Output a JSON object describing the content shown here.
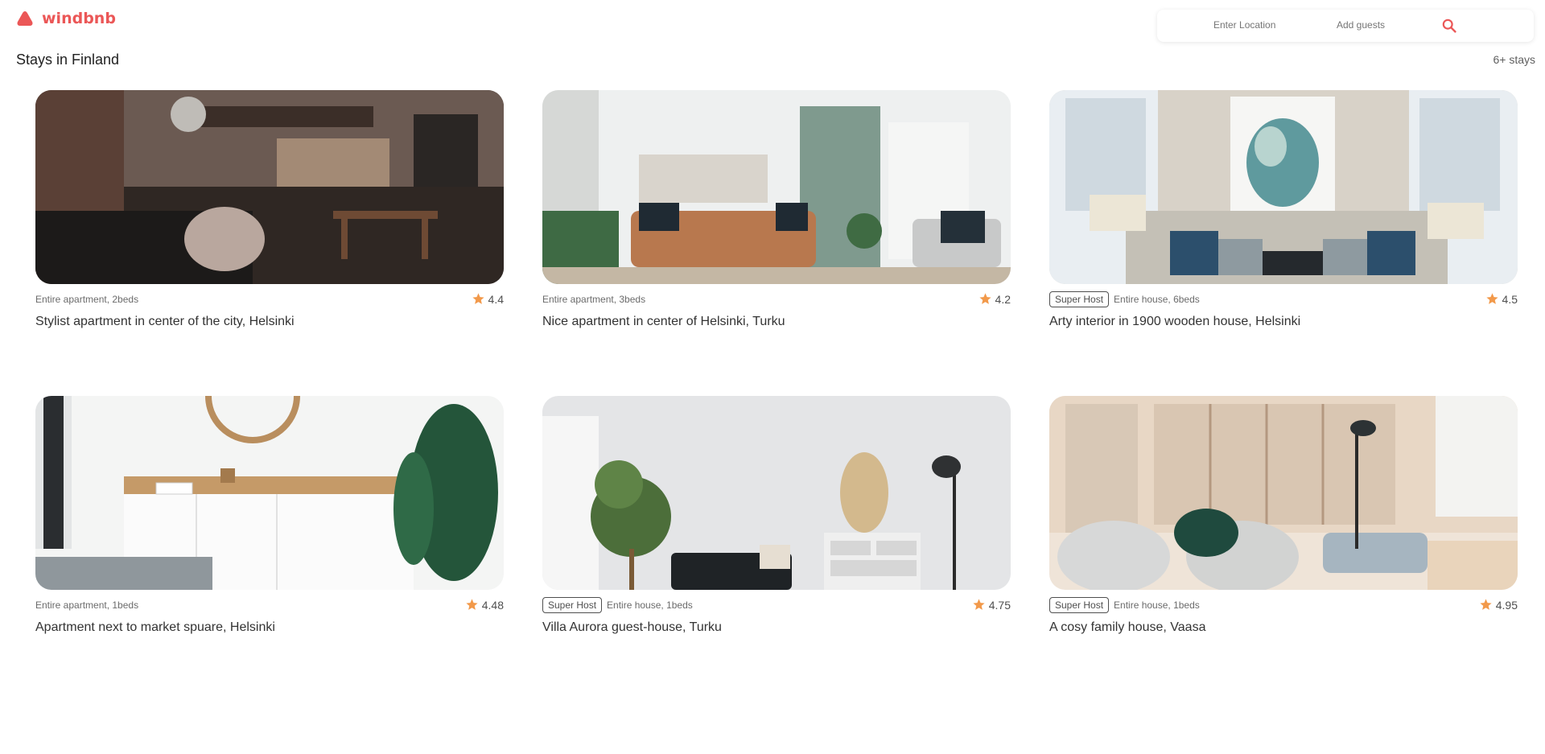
{
  "brand": {
    "name": "windbnb",
    "color": "#eb5757"
  },
  "search": {
    "location_placeholder": "Enter Location",
    "guests_placeholder": "Add guests",
    "search_icon": "search-icon"
  },
  "page": {
    "title": "Stays in Finland",
    "count": "6+ stays"
  },
  "stays": [
    {
      "superhost": false,
      "superhost_label": "",
      "type": "Entire apartment, 2beds",
      "rating": "4.4",
      "title": "Stylist apartment in center of the city, Helsinki",
      "image": "loft-apartment-photo"
    },
    {
      "superhost": false,
      "superhost_label": "",
      "type": "Entire apartment, 3beds",
      "rating": "4.2",
      "title": "Nice apartment in center of Helsinki, Turku",
      "image": "living-room-photo"
    },
    {
      "superhost": true,
      "superhost_label": "Super Host",
      "type": "Entire house, 6beds",
      "rating": "4.5",
      "title": "Arty interior in 1900 wooden house, Helsinki",
      "image": "arty-interior-photo"
    },
    {
      "superhost": false,
      "superhost_label": "",
      "type": "Entire apartment, 1beds",
      "rating": "4.48",
      "title": "Apartment next to market spuare, Helsinki",
      "image": "sideboard-photo"
    },
    {
      "superhost": true,
      "superhost_label": "Super Host",
      "type": "Entire house, 1beds",
      "rating": "4.75",
      "title": "Villa Aurora guest-house, Turku",
      "image": "villa-room-photo"
    },
    {
      "superhost": true,
      "superhost_label": "Super Host",
      "type": "Entire house, 1beds",
      "rating": "4.95",
      "title": "A cosy family house, Vaasa",
      "image": "family-house-photo"
    }
  ],
  "colors": {
    "accent": "#eb5757",
    "star": "#f2994a"
  }
}
